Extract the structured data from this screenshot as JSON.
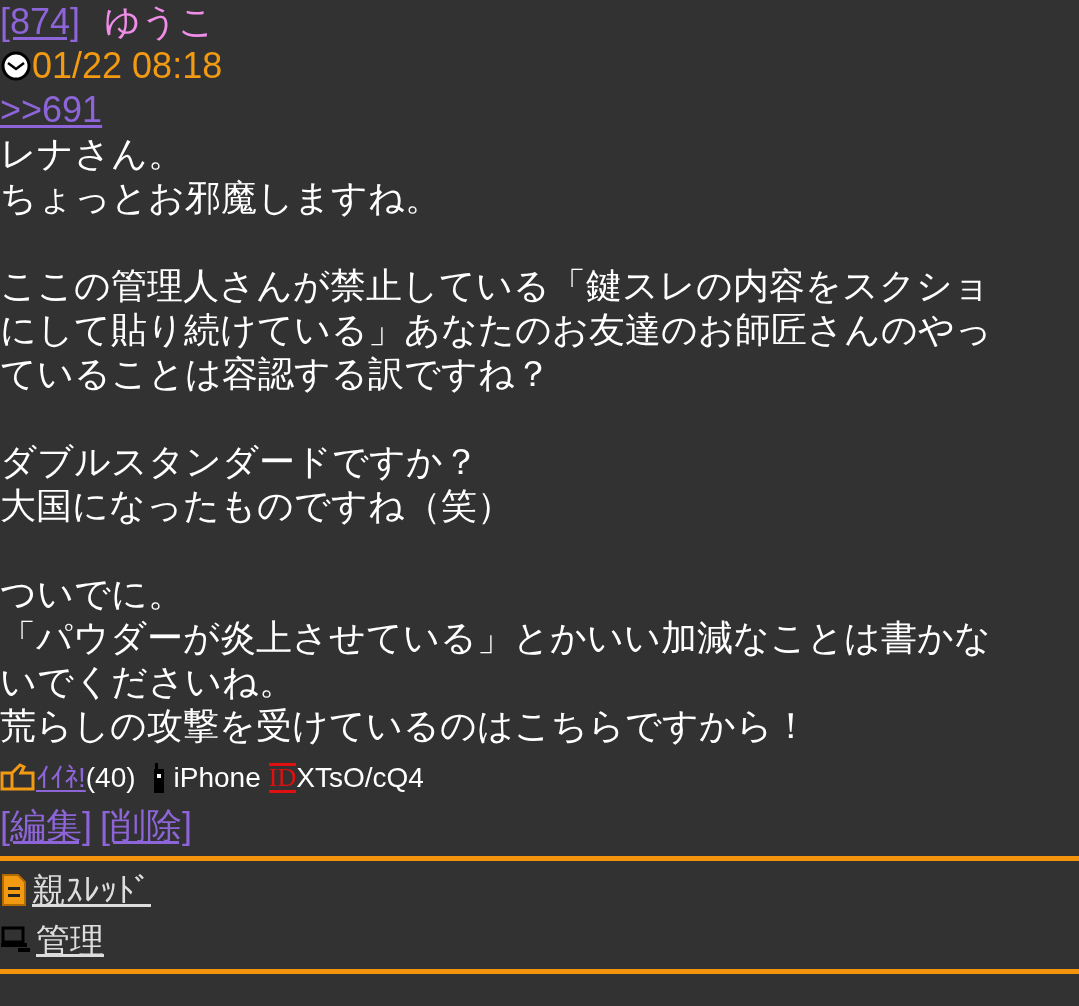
{
  "post": {
    "number": "[874]",
    "author": "ゆうこ",
    "date": "01/22 08:18",
    "reply_link": ">>691",
    "body": [
      [
        "レナさん。",
        "ちょっとお邪魔しますね。"
      ],
      [
        "ここの管理人さんが禁止している「鍵スレの内容をスクショ",
        "にして貼り続けている」あなたのお友達のお師匠さんのやっ",
        "ていることは容認する訳ですね？"
      ],
      [
        "ダブルスタンダードですか？",
        "大国になったものですね（笑）"
      ],
      [
        "ついでに。",
        "「パウダーが炎上させている」とかいい加減なことは書かな",
        "いでくださいね。",
        "荒らしの攻撃を受けているのはこちらですから！"
      ]
    ],
    "like_label": "ｲｲﾈ!",
    "like_count": "(40)",
    "device": "iPhone",
    "id_label": "ID",
    "id_value": "XTsO/cQ4",
    "actions": [
      "[編集]",
      "[削除]"
    ]
  },
  "nav": [
    {
      "kind": "thread",
      "label": "親ｽﾚｯﾄﾞ"
    },
    {
      "kind": "admin",
      "label": "管理"
    }
  ]
}
